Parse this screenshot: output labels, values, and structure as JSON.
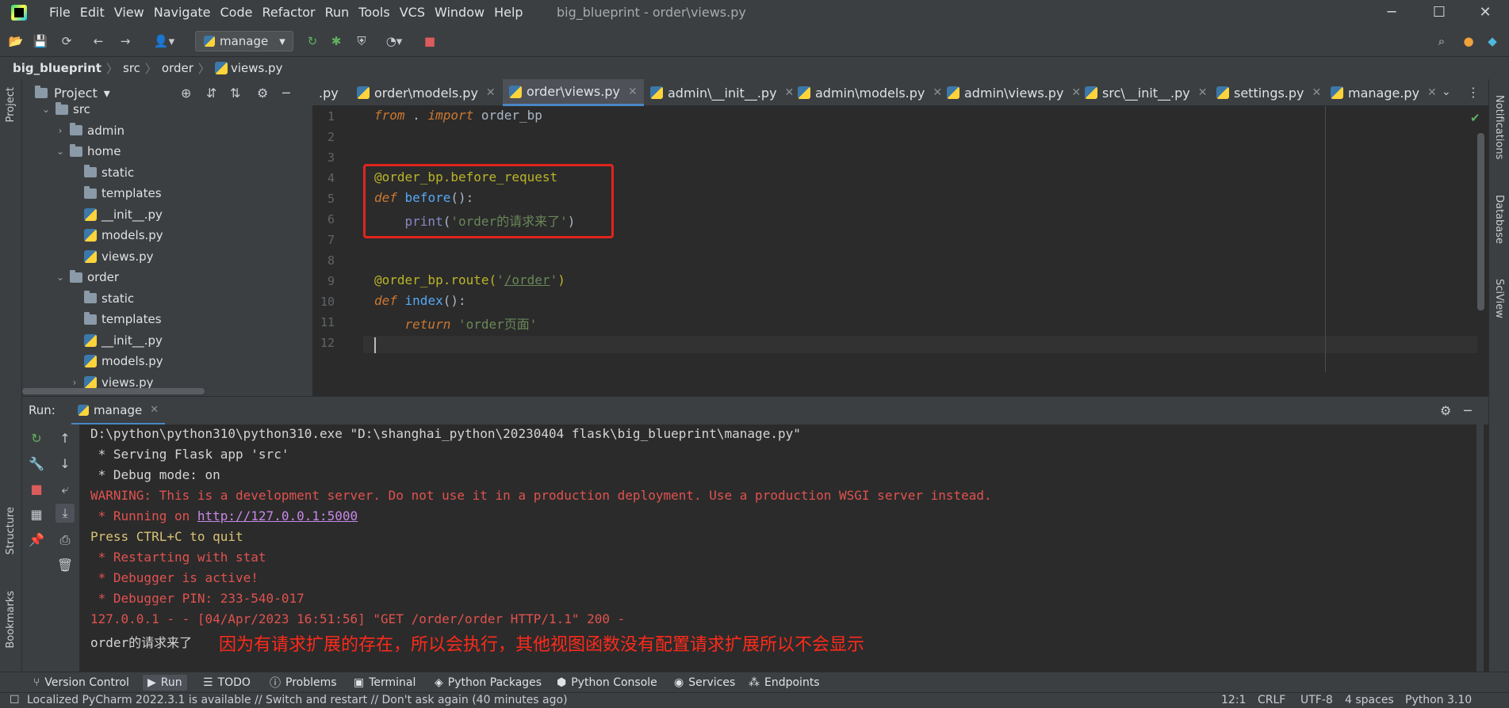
{
  "window": {
    "menu": [
      "File",
      "Edit",
      "View",
      "Navigate",
      "Code",
      "Refactor",
      "Run",
      "Tools",
      "VCS",
      "Window",
      "Help"
    ],
    "title": "big_blueprint - order\\views.py",
    "minimize": "─",
    "maximize": "☐",
    "close": "✕"
  },
  "toolbar": {
    "run_config": "manage",
    "dropdown_arrow": "▾"
  },
  "breadcrumb": [
    "big_blueprint",
    "src",
    "order",
    "views.py"
  ],
  "left_stripe": {
    "project": "Project",
    "structure": "Structure",
    "bookmarks": "Bookmarks"
  },
  "right_stripe": {
    "notifications": "Notifications",
    "database": "Database",
    "sciview": "SciView"
  },
  "project_panel": {
    "title": "Project",
    "tree": [
      {
        "label": "src",
        "type": "folder",
        "level": 0,
        "expanded": "v"
      },
      {
        "label": "admin",
        "type": "folder",
        "level": 1,
        "expanded": ">"
      },
      {
        "label": "home",
        "type": "folder",
        "level": 1,
        "expanded": "v"
      },
      {
        "label": "static",
        "type": "folder",
        "level": 2,
        "expanded": ""
      },
      {
        "label": "templates",
        "type": "folder",
        "level": 2,
        "expanded": ""
      },
      {
        "label": "__init__.py",
        "type": "file",
        "level": 2,
        "expanded": ""
      },
      {
        "label": "models.py",
        "type": "file",
        "level": 2,
        "expanded": ""
      },
      {
        "label": "views.py",
        "type": "file",
        "level": 2,
        "expanded": ""
      },
      {
        "label": "order",
        "type": "folder",
        "level": 1,
        "expanded": "v"
      },
      {
        "label": "static",
        "type": "folder",
        "level": 2,
        "expanded": ""
      },
      {
        "label": "templates",
        "type": "folder",
        "level": 2,
        "expanded": ""
      },
      {
        "label": "__init__.py",
        "type": "file",
        "level": 2,
        "expanded": ""
      },
      {
        "label": "models.py",
        "type": "file",
        "level": 2,
        "expanded": ""
      },
      {
        "label": "views.py",
        "type": "file",
        "level": 2,
        "expanded": ">"
      }
    ]
  },
  "editor_tabs": [
    {
      "label": ".py",
      "active": false,
      "closable": false
    },
    {
      "label": "order\\models.py",
      "active": false,
      "closable": true
    },
    {
      "label": "order\\views.py",
      "active": true,
      "closable": true
    },
    {
      "label": "admin\\__init__.py",
      "active": false,
      "closable": true
    },
    {
      "label": "admin\\models.py",
      "active": false,
      "closable": true
    },
    {
      "label": "admin\\views.py",
      "active": false,
      "closable": true
    },
    {
      "label": "src\\__init__.py",
      "active": false,
      "closable": true
    },
    {
      "label": "settings.py",
      "active": false,
      "closable": true
    },
    {
      "label": "manage.py",
      "active": false,
      "closable": true
    }
  ],
  "code": {
    "line_numbers": [
      "1",
      "2",
      "3",
      "4",
      "5",
      "6",
      "7",
      "8",
      "9",
      "10",
      "11",
      "12"
    ],
    "l1_from": "from",
    "l1_dot": " . ",
    "l1_import": "import",
    "l1_mod": " order_bp",
    "l4": "@order_bp.before_request",
    "l5_def": "def",
    "l5_name": " before",
    "l5_rest": "():",
    "l6_indent": "    ",
    "l6_print": "print",
    "l6_open": "(",
    "l6_str": "'order的请求来了'",
    "l6_close": ")",
    "l9_dec": "@order_bp.route(",
    "l9_q1": "'",
    "l9_path": "/order",
    "l9_q2": "'",
    "l9_close": ")",
    "l10_def": "def",
    "l10_name": " index",
    "l10_rest": "():",
    "l11_indent": "    ",
    "l11_return": "return",
    "l11_str": " 'order页面'"
  },
  "run_panel": {
    "label": "Run:",
    "tab": "manage",
    "tab_close": "✕"
  },
  "console": [
    {
      "text": "D:\\python\\python310\\python310.exe \"D:\\shanghai_python\\20230404 flask\\big_blueprint\\manage.py\"",
      "color": "white"
    },
    {
      "text": " * Serving Flask app 'src'",
      "color": "white"
    },
    {
      "text": " * Debug mode: on",
      "color": "white"
    },
    {
      "text": "WARNING: This is a development server. Do not use it in a production deployment. Use a production WSGI server instead.",
      "color": "red"
    },
    {
      "text": " * Running on ",
      "color": "red",
      "link": "http://127.0.0.1:5000"
    },
    {
      "text": "Press CTRL+C to quit",
      "color": "yellow"
    },
    {
      "text": " * Restarting with stat",
      "color": "red"
    },
    {
      "text": " * Debugger is active!",
      "color": "red"
    },
    {
      "text": " * Debugger PIN: 233-540-017",
      "color": "red"
    },
    {
      "text": "127.0.0.1 - - [04/Apr/2023 16:51:56] \"GET /order/order HTTP/1.1\" 200 -",
      "color": "red"
    },
    {
      "text": "order的请求来了",
      "color": "white"
    }
  ],
  "annotation": "因为有请求扩展的存在，所以会执行，其他视图函数没有配置请求扩展所以不会显示",
  "bottom_tools": [
    "Version Control",
    "Run",
    "TODO",
    "Problems",
    "Terminal",
    "Python Packages",
    "Python Console",
    "Services",
    "Endpoints"
  ],
  "status_bar": {
    "message": "Localized PyCharm 2022.3.1 is available // Switch and restart // Don't ask again (40 minutes ago)",
    "position": "12:1",
    "line_sep": "CRLF",
    "encoding": "UTF-8",
    "indent": "4 spaces",
    "interpreter": "Python 3.10"
  },
  "colors": {
    "accent": "#4a88c7",
    "highlight_box": "#e0251e",
    "annotation": "#ff2a1a"
  }
}
